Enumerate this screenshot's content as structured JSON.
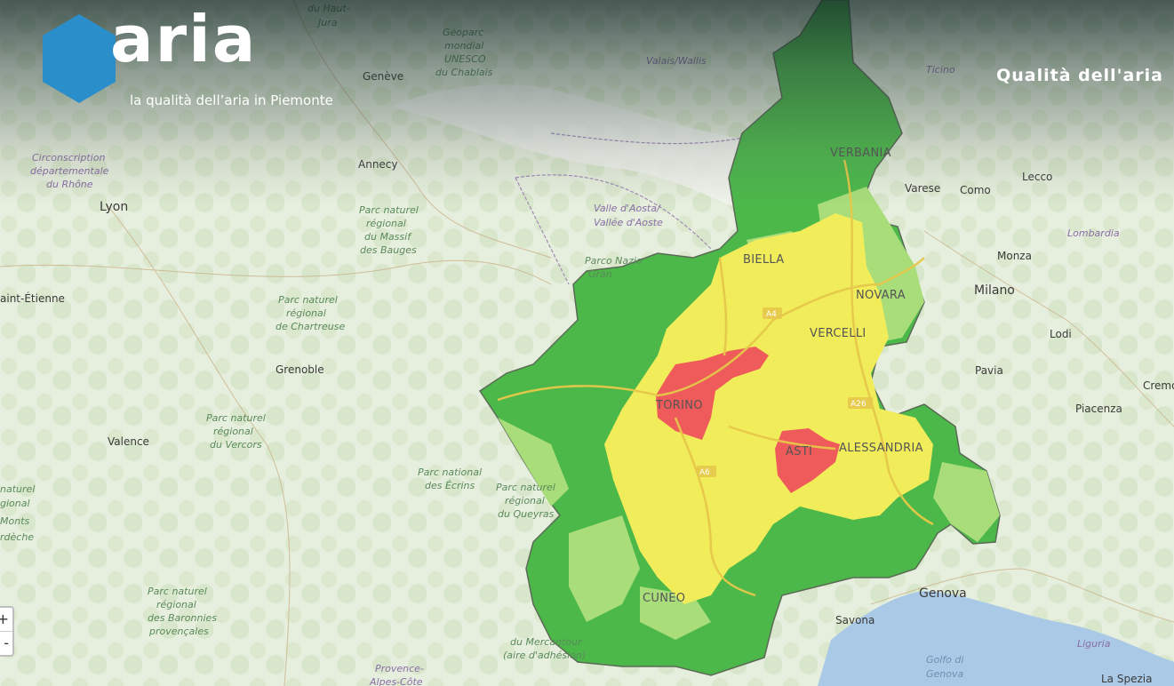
{
  "header": {
    "logo_text": "aria",
    "tagline": "la qualità dell’aria in Piemonte",
    "title": "Qualità dell'aria"
  },
  "zoom": {
    "in_label": "+",
    "out_label": "-"
  },
  "colors": {
    "accent": "#2a8ecb",
    "aq_good": "#4cb84a",
    "aq_fair": "#a8dd7a",
    "aq_moderate": "#f0ec5a",
    "aq_poor": "#ef5a5a",
    "sea": "#a9c9e6"
  },
  "provinces": [
    "VERBANIA",
    "BIELLA",
    "NOVARA",
    "VERCELLI",
    "TORINO",
    "ASTI",
    "ALESSANDRIA",
    "CUNEO"
  ],
  "motorways": [
    "A4",
    "A26",
    "A6"
  ],
  "basemap_labels": {
    "cities": [
      "Lyon",
      "Genève",
      "Annecy",
      "Grenoble",
      "Valence",
      "Varese",
      "Como",
      "Lecco",
      "Monza",
      "Milano",
      "Lodi",
      "Pavia",
      "Piacenza",
      "Cremo",
      "Savona",
      "La Spezia"
    ],
    "big_cities": [
      "Milano",
      "Genova"
    ],
    "regions": [
      "Valle d'Aosta/",
      "Vallée d'Aoste",
      "Valais/Wallis",
      "Ticino",
      "Lombardia",
      "Liguria",
      "Provence-",
      "Alpes-Côte"
    ],
    "water": [
      "Golfo di",
      "Genova"
    ],
    "parks": [
      "du Haut-",
      "Jura",
      "Géoparc",
      "mondial",
      "UNESCO",
      "du Chablais",
      "Circonscription",
      "départementale",
      "du Rhône",
      "Parc naturel",
      "régional",
      "du Massif",
      "des Bauges",
      "Parc naturel",
      "régional",
      "de Chartreuse",
      "Parc naturel",
      "régional",
      "du Vercors",
      "Parc national",
      "des Écrins",
      "Parc naturel",
      "régional",
      "du Queyras",
      "Parc naturel",
      "régional",
      "des Baronnies",
      "provençales",
      "du Mercantour",
      "(aire d'adhésion)",
      "Parco Nazio",
      "Gran",
      "aint-Étienne",
      "naturel",
      "gional",
      "Monts",
      "rdèche"
    ]
  }
}
